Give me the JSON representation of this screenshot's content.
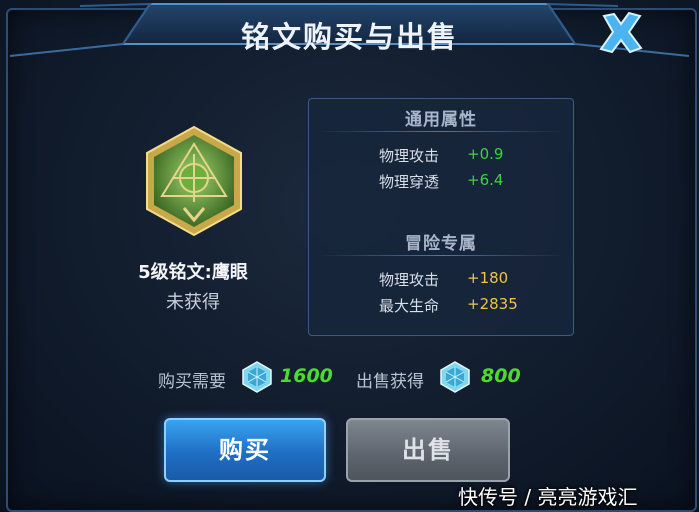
{
  "window": {
    "title": "铭文购买与出售",
    "close_icon": "close-x-icon"
  },
  "item": {
    "name": "5级铭文:鹰眼",
    "status": "未获得",
    "emblem_icon": "inscription-emblem-icon"
  },
  "general_attributes": {
    "title": "通用属性",
    "stats": [
      {
        "name": "物理攻击",
        "value": "+0.9"
      },
      {
        "name": "物理穿透",
        "value": "+6.4"
      }
    ]
  },
  "adventure_attributes": {
    "title": "冒险专属",
    "stats": [
      {
        "name": "物理攻击",
        "value": "+180"
      },
      {
        "name": "最大生命",
        "value": "+2835"
      }
    ]
  },
  "pricing": {
    "buy_label": "购买需要",
    "buy_value": "1600",
    "sell_label": "出售获得",
    "sell_value": "800",
    "currency_icon": "crystal-gem-icon"
  },
  "buttons": {
    "buy": "购买",
    "sell": "出售"
  },
  "watermark": "快传号 / 亮亮游戏汇",
  "colors": {
    "positive_stat": "#3ad43a",
    "adventure_stat": "#ebc44a",
    "price": "#4bdc2e",
    "buy_button": "#1f6fc4",
    "sell_button": "#5d646d"
  }
}
